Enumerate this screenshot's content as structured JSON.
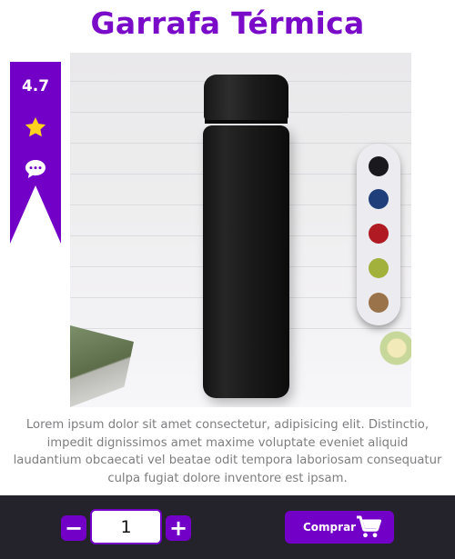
{
  "product": {
    "title": "Garrafa Térmica",
    "description": "Lorem ipsum dolor sit amet consectetur, adipisicing elit. Distinctio, impedit dignissimos amet maxime voluptate eveniet aliquid laudantium obcaecati vel beatae odit tempora laboriosam consequatur culpa fugiat dolore inventore est ipsam."
  },
  "ribbon": {
    "rating": "4.7",
    "icons": [
      "star-icon",
      "comment-icon"
    ]
  },
  "colors": [
    "#1a1a1e",
    "#1f3f7a",
    "#b01a22",
    "#a2b13b",
    "#9a734a"
  ],
  "cart": {
    "quantity": "1",
    "minus_label": "−",
    "plus_label": "+",
    "buy_label": "Comprar"
  },
  "theme": {
    "accent": "#7300c6",
    "bar": "#24222a"
  }
}
